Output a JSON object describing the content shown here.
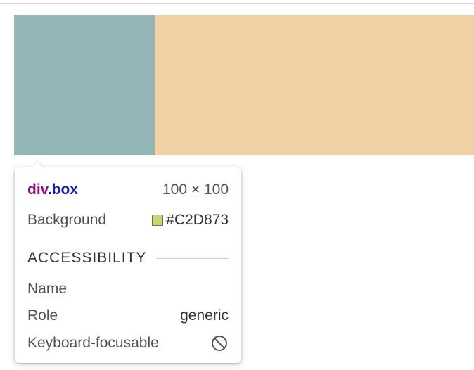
{
  "colors": {
    "box_teal": "#93B7B6",
    "box_peach": "#F0D2A6",
    "swatch": "#C2D873"
  },
  "tooltip": {
    "selector_tag": "div",
    "selector_class": ".box",
    "dimensions": "100 × 100",
    "background_label": "Background",
    "background_value": "#C2D873",
    "accessibility_heading": "ACCESSIBILITY",
    "name_label": "Name",
    "name_value": "",
    "role_label": "Role",
    "role_value": "generic",
    "keyboard_label": "Keyboard-focusable",
    "keyboard_icon": "not-allowed-icon"
  }
}
